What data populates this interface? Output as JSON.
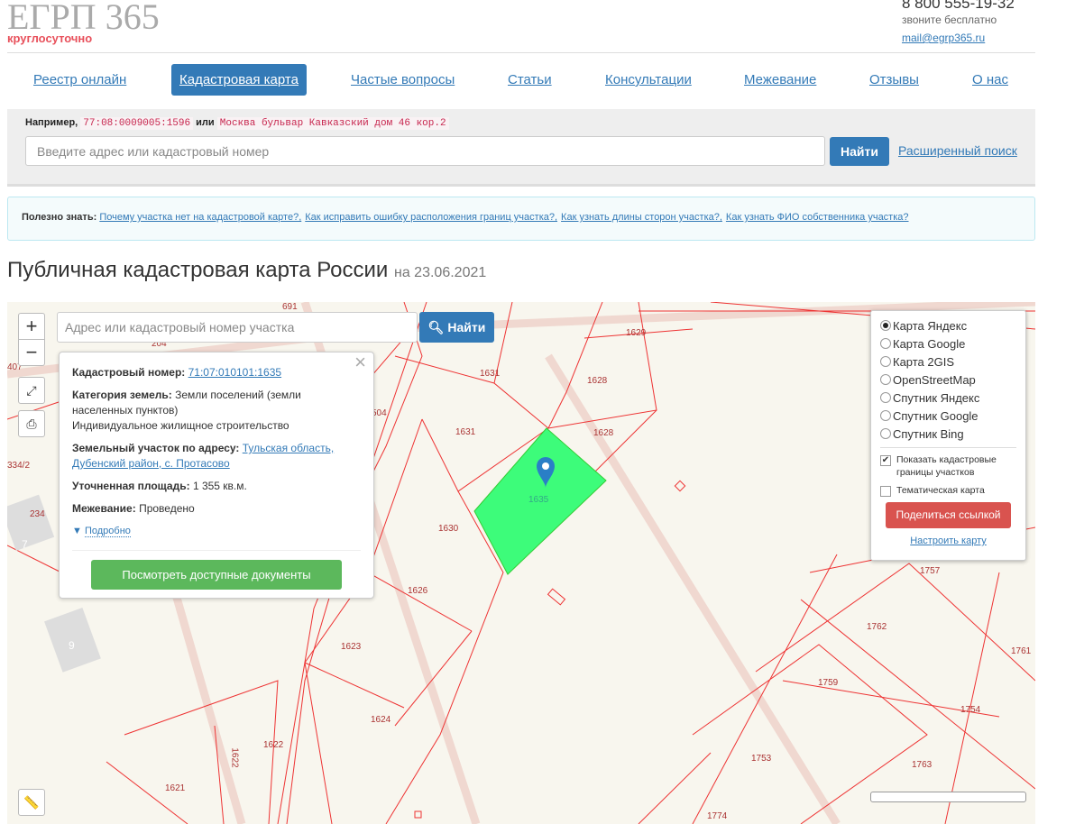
{
  "header": {
    "logo": "ЕГРП 365",
    "logo_sub": "круглосуточно",
    "phone": "8 800 555-19-32",
    "phone_note": "звоните бесплатно",
    "email": "mail@egrp365.ru"
  },
  "nav": [
    "Реестр онлайн",
    "Кадастровая карта",
    "Частые вопросы",
    "Статьи",
    "Консультации",
    "Межевание",
    "Отзывы",
    "О нас"
  ],
  "search": {
    "example_label": "Например,",
    "example1": "77:08:0009005:1596",
    "or": "или",
    "example2": "Москва бульвар Кавказский дом 46 кор.2",
    "placeholder": "Введите адрес или кадастровый номер",
    "button": "Найти",
    "advanced": "Расширенный поиск"
  },
  "tip": {
    "label": "Полезно знать:",
    "links": [
      "Почему участка нет на кадастровой карте?,",
      "Как исправить ошибку расположения границ участка?,",
      "Как узнать длины сторон участка?,",
      "Как узнать ФИО собственника участка?"
    ]
  },
  "page": {
    "title": "Публичная кадастровая карта России",
    "date": "на 23.06.2021"
  },
  "map": {
    "search_placeholder": "Адрес или кадастровый номер участка",
    "search_button": "Найти",
    "zoom_in": "+",
    "zoom_out": "−",
    "popup": {
      "cad_label": "Кадастровый номер:",
      "cad_value": "71:07:010101:1635",
      "cat_label": "Категория земель:",
      "cat_value": "Земли поселений (земли населенных пунктов)",
      "use": "Индивидуальное жилищное строительство",
      "addr_label": "Земельный участок по адресу:",
      "addr_value": "Тульская область, Дубенский район, с. Протасово",
      "area_label": "Уточненная площадь:",
      "area_value": "1 355 кв.м.",
      "survey_label": "Межевание:",
      "survey_value": "Проведено",
      "more": "Подробно",
      "docs_button": "Посмотреть доступные документы"
    },
    "layers": [
      "Карта Яндекс",
      "Карта Google",
      "Карта 2GIS",
      "OpenStreetMap",
      "Спутник Яндекс",
      "Спутник Google",
      "Спутник Bing"
    ],
    "selected_layer": "Карта Яндекс",
    "show_borders": "Показать кадастровые границы участков",
    "show_borders_checked": true,
    "thematic": "Тематическая карта",
    "thematic_checked": false,
    "share": "Поделиться ссылкой",
    "setup": "Настроить карту",
    "parcels": [
      "691",
      "1629",
      "1631",
      "1628",
      "1628",
      "1631",
      "1635",
      "1630",
      "1626",
      "1623",
      "1624",
      "1622",
      "1621",
      "1622",
      "1757",
      "1762",
      "1761",
      "1759",
      "1754",
      "1753",
      "1763",
      "1774",
      "204",
      "407",
      "334/2",
      "234",
      "504",
      "7",
      "9"
    ],
    "colors": {
      "selected": "#3dfc7a",
      "border": "#e33"
    }
  }
}
